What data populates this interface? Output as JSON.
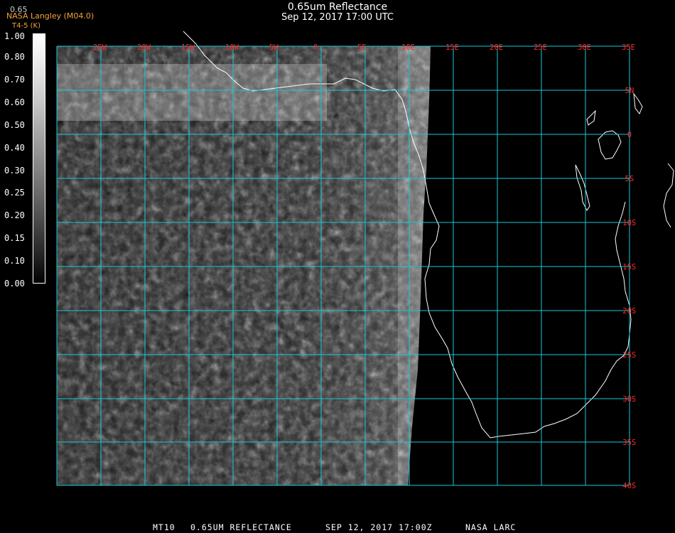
{
  "title": "0.65um Reflectance",
  "subtitle": "Sep 12, 2017 17:00 UTC",
  "credit": "NASA Langley (M04.0)",
  "credit_sub": "T4-5 (K)",
  "colorbar_value": "0.65",
  "colorbar_labels": [
    "1.00",
    "0.80",
    "0.70",
    "0.60",
    "0.50",
    "0.40",
    "0.30",
    "0.25",
    "0.20",
    "0.15",
    "0.10",
    "0.00"
  ],
  "lon_labels": [
    "25W",
    "20W",
    "15W",
    "10W",
    "5W",
    "0",
    "5E",
    "10E",
    "15E",
    "20E",
    "25E",
    "30E",
    "35E"
  ],
  "lat_labels": [
    "5N",
    "0",
    "5S",
    "10S",
    "15S",
    "20S",
    "25S",
    "30S",
    "35S",
    "40S"
  ],
  "footer": {
    "product": "MT10",
    "name": "0.65UM REFLECTANCE",
    "date": "SEP 12, 2017 17:00Z",
    "org": "NASA LARC"
  },
  "colors": {
    "grid": "#19c8d8",
    "labels": "#ff2a2a",
    "credit": "#f2a33a"
  }
}
